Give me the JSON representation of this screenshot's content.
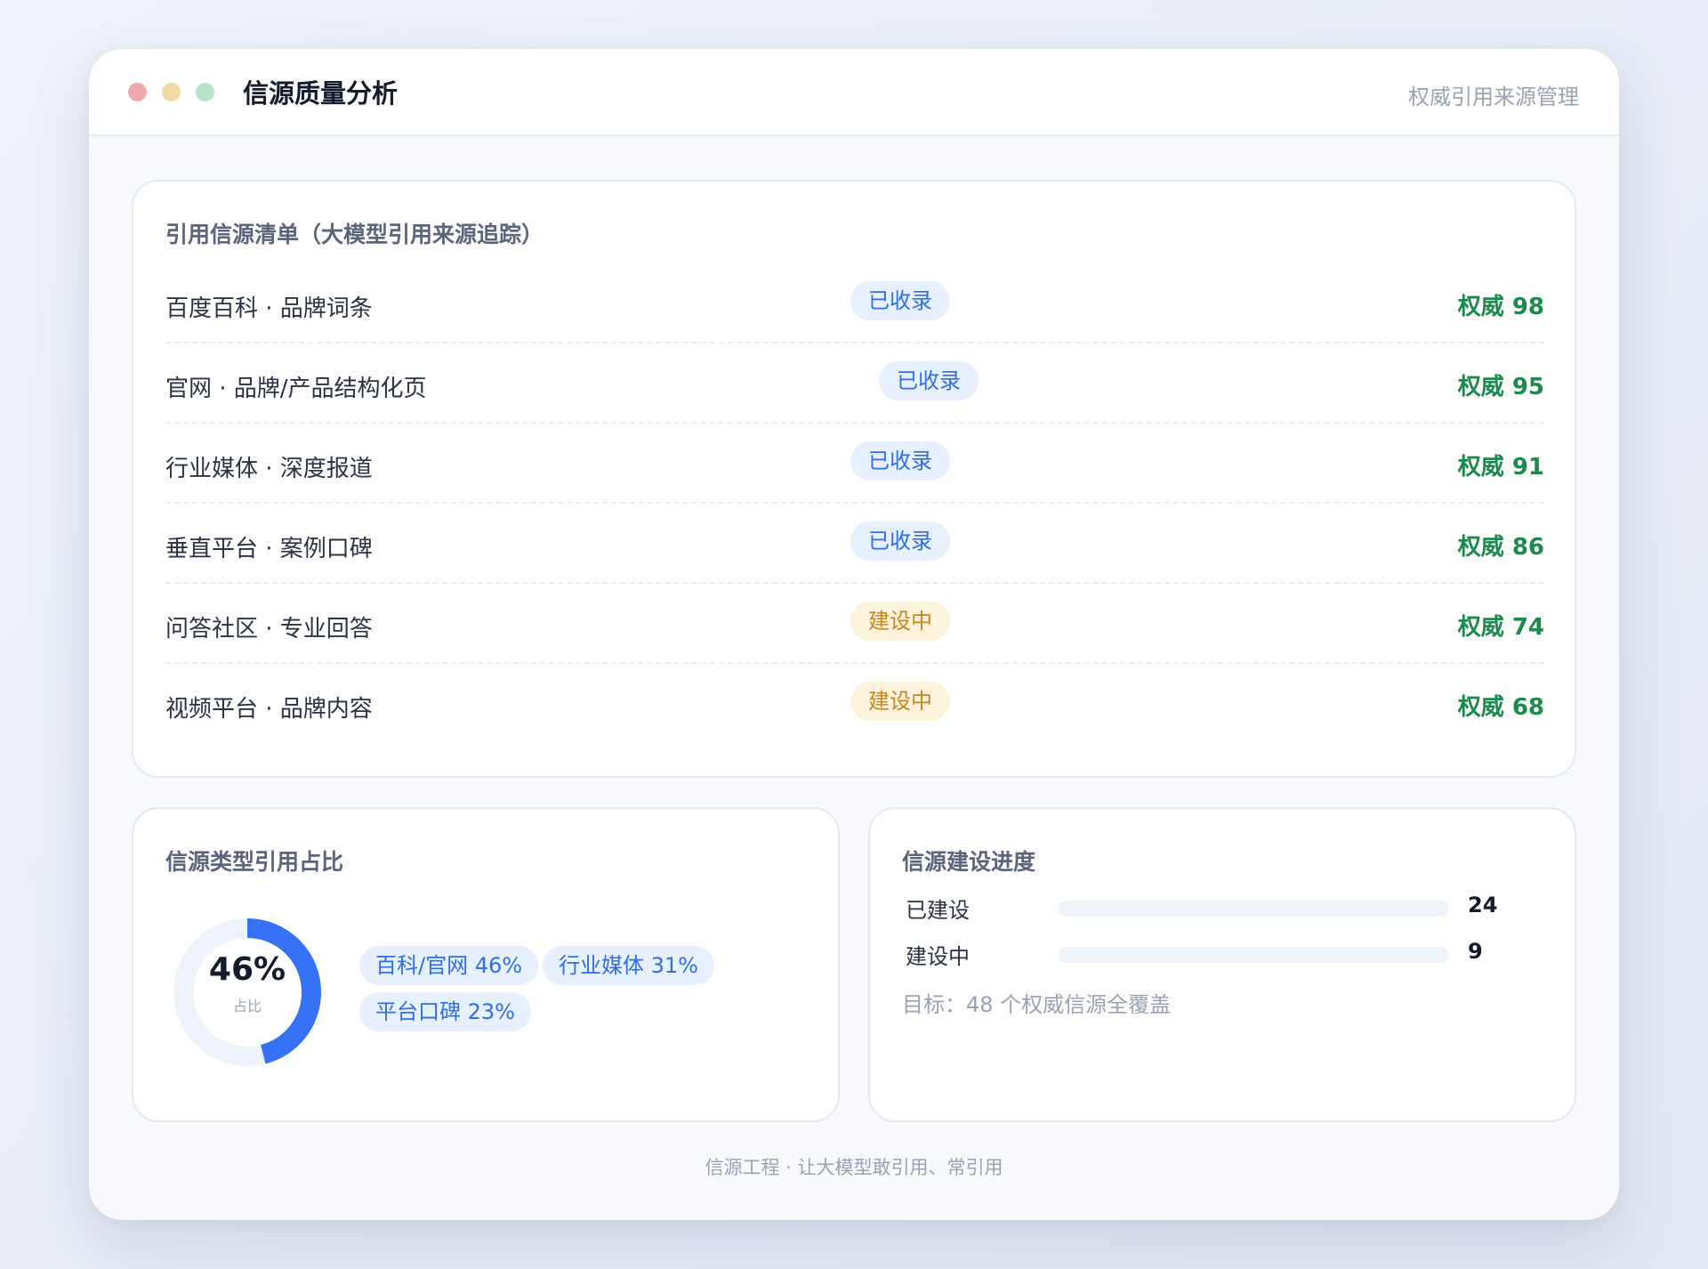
{
  "window": {
    "title": "信源质量分析",
    "subtitle": "权威引用来源管理"
  },
  "sources": {
    "title": "引用信源清单（大模型引用来源追踪）",
    "rows": [
      {
        "name": "百度百科 · 品牌词条",
        "status": "已收录",
        "status_type": "done",
        "score": "权威 98"
      },
      {
        "name": "官网 · 品牌/产品结构化页",
        "status": "已收录",
        "status_type": "done",
        "score": "权威 95"
      },
      {
        "name": "行业媒体 · 深度报道",
        "status": "已收录",
        "status_type": "done",
        "score": "权威 91"
      },
      {
        "name": "垂直平台 · 案例口碑",
        "status": "已收录",
        "status_type": "done",
        "score": "权威 86"
      },
      {
        "name": "问答社区 · 专业回答",
        "status": "建设中",
        "status_type": "building",
        "score": "权威 74"
      },
      {
        "name": "视频平台 · 品牌内容",
        "status": "建设中",
        "status_type": "building",
        "score": "权威 68"
      }
    ]
  },
  "ratio": {
    "title": "信源类型引用占比",
    "donut_value": "46%",
    "donut_label": "占比",
    "donut_fraction": 0.46,
    "chips": [
      "百科/官网 46%",
      "行业媒体 31%",
      "平台口碑 23%"
    ]
  },
  "progress": {
    "title": "信源建设进度",
    "items": [
      {
        "label": "已建设",
        "value": "24"
      },
      {
        "label": "建设中",
        "value": "9"
      }
    ],
    "note": "目标：48 个权威信源全覆盖"
  },
  "footer": "信源工程 · 让大模型敢引用、常引用",
  "colors": {
    "accent": "#3572f6",
    "authority_green": "#1c8a4c",
    "badge_done": "#2f6ee6",
    "badge_building": "#c6871e"
  }
}
